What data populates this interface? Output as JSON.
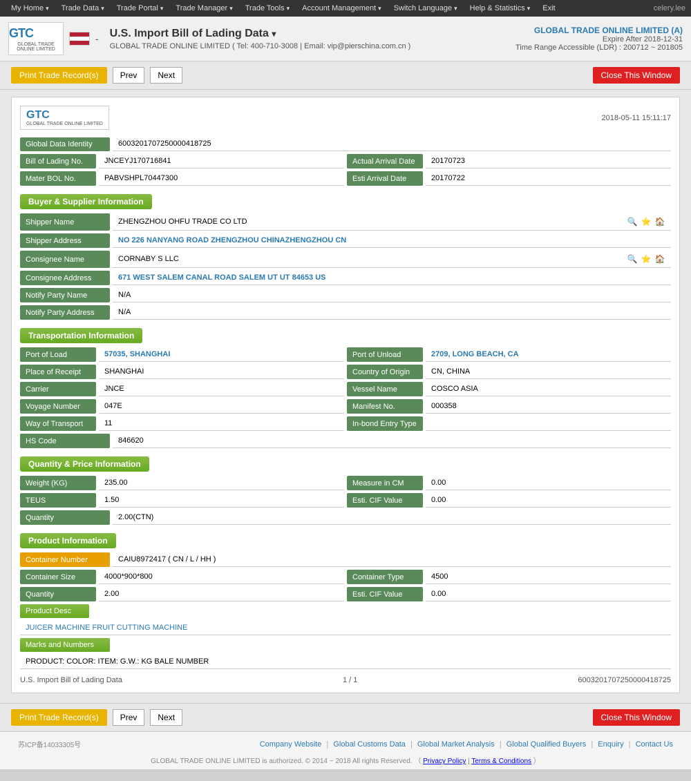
{
  "topnav": {
    "items": [
      {
        "label": "My Home",
        "id": "my-home"
      },
      {
        "label": "Trade Data",
        "id": "trade-data"
      },
      {
        "label": "Trade Portal",
        "id": "trade-portal"
      },
      {
        "label": "Trade Manager",
        "id": "trade-manager"
      },
      {
        "label": "Trade Tools",
        "id": "trade-tools"
      },
      {
        "label": "Account Management",
        "id": "account-management"
      },
      {
        "label": "Switch Language",
        "id": "switch-language"
      },
      {
        "label": "Help & Statistics",
        "id": "help-statistics"
      },
      {
        "label": "Exit",
        "id": "exit"
      }
    ],
    "user": "celery.lee"
  },
  "header": {
    "title": "U.S. Import Bill of Lading Data",
    "subtitle": "GLOBAL TRADE ONLINE LIMITED ( Tel: 400-710-3008 | Email: vip@pierschina.com.cn )",
    "company": "GLOBAL TRADE ONLINE LIMITED (A)",
    "expire": "Expire After 2018-12-31",
    "ldr": "Time Range Accessible (LDR) : 200712 ~ 201805"
  },
  "actions": {
    "print_label": "Print Trade Record(s)",
    "prev_label": "Prev",
    "next_label": "Next",
    "close_label": "Close This Window"
  },
  "record": {
    "logo_subtitle": "GLOBAL TRADE ONLINE LIMITED",
    "timestamp": "2018-05-11 15:11:17",
    "global_data_identity_label": "Global Data Identity",
    "global_data_identity_value": "6003201707250000418725",
    "bill_of_lading_label": "Bill of Lading No.",
    "bill_of_lading_value": "JNCEYJ170716841",
    "actual_arrival_date_label": "Actual Arrival Date",
    "actual_arrival_date_value": "20170723",
    "mater_bol_label": "Mater BOL No.",
    "mater_bol_value": "PABVSHPL70447300",
    "esti_arrival_date_label": "Esti Arrival Date",
    "esti_arrival_date_value": "20170722"
  },
  "buyer_supplier": {
    "section_label": "Buyer & Supplier Information",
    "shipper_name_label": "Shipper Name",
    "shipper_name_value": "ZHENGZHOU OHFU TRADE CO LTD",
    "shipper_address_label": "Shipper Address",
    "shipper_address_value": "NO 226 NANYANG ROAD ZHENGZHOU CHINAZHENGZHOU CN",
    "consignee_name_label": "Consignee Name",
    "consignee_name_value": "CORNABY S LLC",
    "consignee_address_label": "Consignee Address",
    "consignee_address_value": "671 WEST SALEM CANAL ROAD SALEM UT UT 84653 US",
    "notify_party_name_label": "Notify Party Name",
    "notify_party_name_value": "N/A",
    "notify_party_address_label": "Notify Party Address",
    "notify_party_address_value": "N/A"
  },
  "transportation": {
    "section_label": "Transportation Information",
    "port_of_load_label": "Port of Load",
    "port_of_load_value": "57035, SHANGHAI",
    "port_of_unload_label": "Port of Unload",
    "port_of_unload_value": "2709, LONG BEACH, CA",
    "place_of_receipt_label": "Place of Receipt",
    "place_of_receipt_value": "SHANGHAI",
    "country_of_origin_label": "Country of Origin",
    "country_of_origin_value": "CN, CHINA",
    "carrier_label": "Carrier",
    "carrier_value": "JNCE",
    "vessel_name_label": "Vessel Name",
    "vessel_name_value": "COSCO ASIA",
    "voyage_number_label": "Voyage Number",
    "voyage_number_value": "047E",
    "manifest_no_label": "Manifest No.",
    "manifest_no_value": "000358",
    "way_of_transport_label": "Way of Transport",
    "way_of_transport_value": "11",
    "inbond_entry_type_label": "In-bond Entry Type",
    "inbond_entry_type_value": "",
    "hs_code_label": "HS Code",
    "hs_code_value": "846620"
  },
  "quantity_price": {
    "section_label": "Quantity & Price Information",
    "weight_label": "Weight (KG)",
    "weight_value": "235.00",
    "measure_cm_label": "Measure in CM",
    "measure_cm_value": "0.00",
    "teus_label": "TEUS",
    "teus_value": "1.50",
    "esti_cif_label": "Esti. CIF Value",
    "esti_cif_value": "0.00",
    "quantity_label": "Quantity",
    "quantity_value": "2.00(CTN)"
  },
  "product": {
    "section_label": "Product Information",
    "container_number_label": "Container Number",
    "container_number_value": "CAIU8972417 ( CN / L / HH )",
    "container_size_label": "Container Size",
    "container_size_value": "4000*900*800",
    "container_type_label": "Container Type",
    "container_type_value": "4500",
    "quantity_label": "Quantity",
    "quantity_value": "2.00",
    "esti_cif_label": "Esti. CIF Value",
    "esti_cif_value": "0.00",
    "product_desc_label": "Product Desc",
    "product_desc_value": "JUICER MACHINE FRUIT CUTTING MACHINE",
    "marks_label": "Marks and Numbers",
    "marks_value": "PRODUCT: COLOR: ITEM: G.W.: KG BALE NUMBER"
  },
  "card_footer": {
    "doc_label": "U.S. Import Bill of Lading Data",
    "page": "1 / 1",
    "record_id": "6003201707250000418725"
  },
  "footer": {
    "icp": "苏ICP备14033305号",
    "links": [
      "Company Website",
      "Global Customs Data",
      "Global Market Analysis",
      "Global Qualified Buyers",
      "Enquiry",
      "Contact Us"
    ],
    "copyright": "GLOBAL TRADE ONLINE LIMITED is authorized. © 2014 ~ 2018 All rights Reserved. （",
    "privacy": "Privacy Policy",
    "separator": "|",
    "terms": "Terms & Conditions",
    "copyright_end": "）"
  }
}
